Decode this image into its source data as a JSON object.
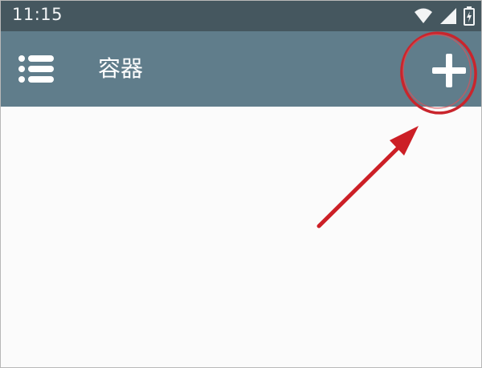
{
  "status_bar": {
    "time": "11:15",
    "icons": [
      "wifi-icon",
      "cell-signal-icon",
      "battery-icon"
    ]
  },
  "app_bar": {
    "title": "容器",
    "menu_icon": "menu-list-icon",
    "add_icon": "plus-icon"
  },
  "annotation": {
    "circle_color": "#c9252c",
    "arrow_color": "#cc1f26",
    "target": "add-button"
  },
  "colors": {
    "status_bar": "#45575f",
    "app_bar": "#607d8b",
    "content_bg": "#fbfbfb"
  }
}
